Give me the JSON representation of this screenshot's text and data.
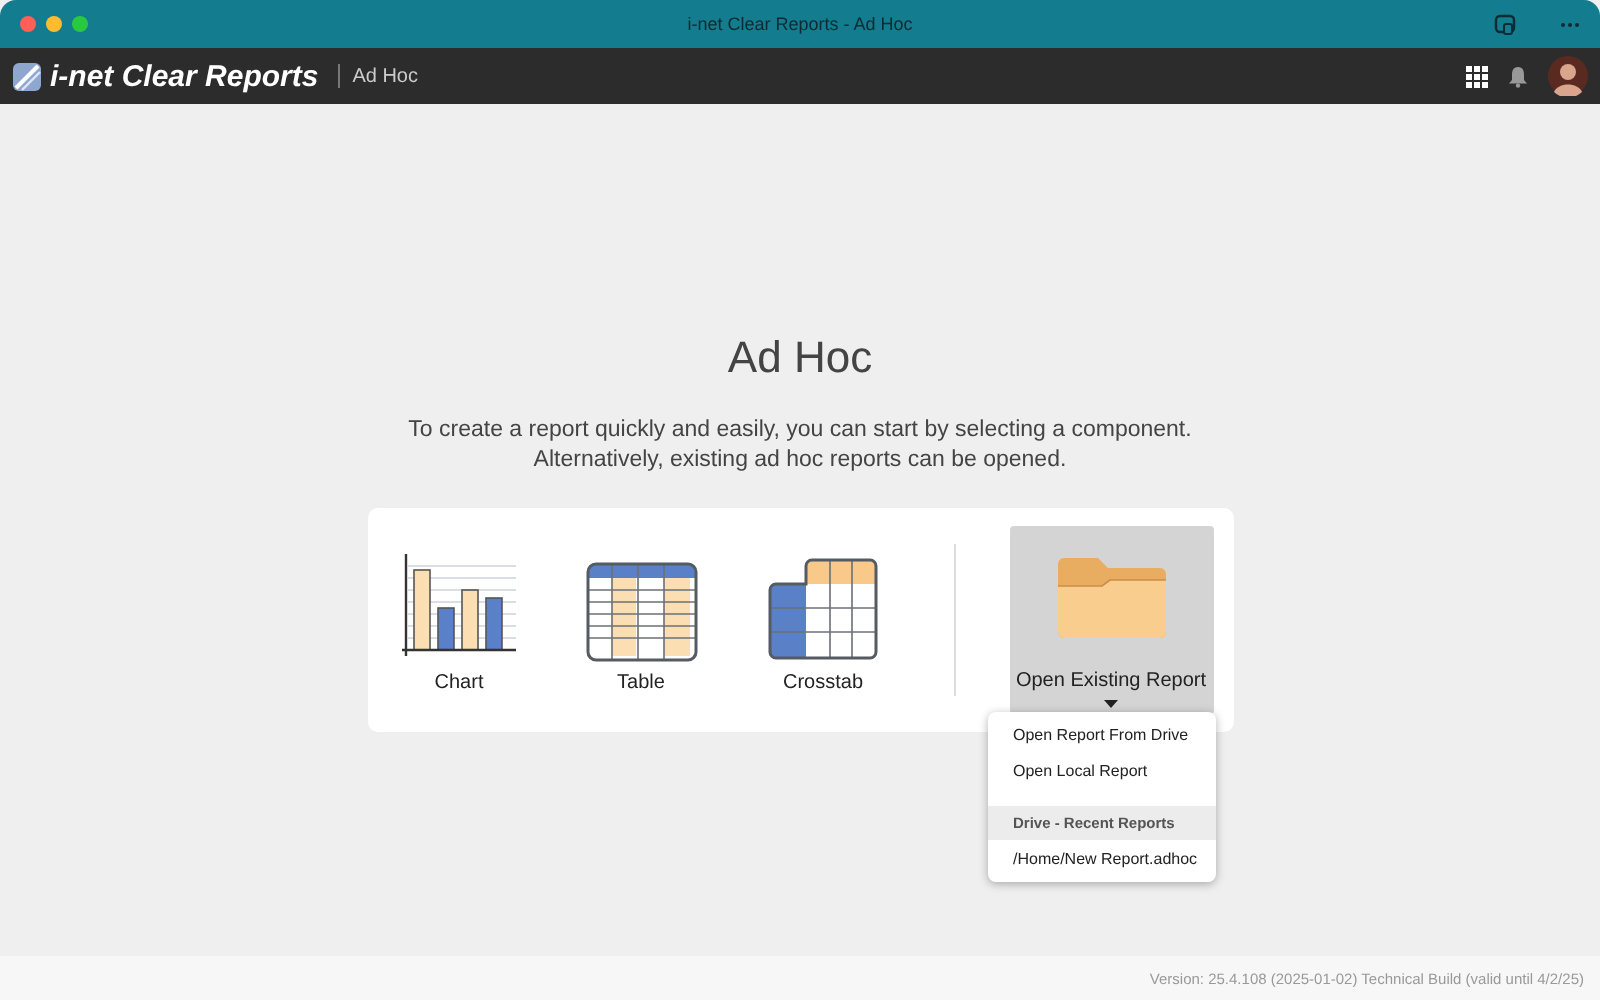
{
  "window": {
    "title": "i-net Clear Reports - Ad Hoc"
  },
  "header": {
    "app_name": "i-net Clear Reports",
    "breadcrumb": "Ad Hoc"
  },
  "main": {
    "heading": "Ad Hoc",
    "description_lines": [
      "To create a report quickly and easily, you can start by selecting a component.",
      "Alternatively, existing ad hoc reports can be opened."
    ]
  },
  "components": [
    {
      "kind": "chart",
      "label": "Chart"
    },
    {
      "kind": "table",
      "label": "Table"
    },
    {
      "kind": "crosstab",
      "label": "Crosstab"
    }
  ],
  "open_button": {
    "label": "Open Existing Report",
    "expanded": true
  },
  "menu": [
    {
      "kind": "item",
      "label": "Open Report From Drive"
    },
    {
      "kind": "item",
      "label": "Open Local Report"
    },
    {
      "kind": "header",
      "label": "Drive - Recent Reports"
    },
    {
      "kind": "item",
      "label": "/Home/New Report.adhoc"
    }
  ],
  "footer": {
    "version": "Version: 25.4.108 (2025-01-02) Technical Build (valid until 4/2/25)"
  }
}
